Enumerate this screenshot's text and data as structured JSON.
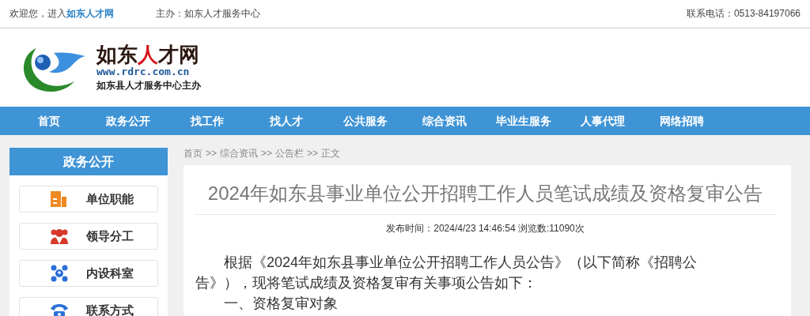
{
  "top_bar": {
    "welcome": "欢迎您，进入",
    "site_link": "如东人才网",
    "host": "主办：如东人才服务中心",
    "phone": "联系电话：0513-84197066"
  },
  "logo": {
    "title_parts": [
      {
        "text": "如东",
        "accent": false
      },
      {
        "text": "人",
        "accent": true
      },
      {
        "text": "才网",
        "accent": false
      }
    ],
    "url": "www.rdrc.com.cn",
    "subtitle": "如东县人才服务中心主办"
  },
  "nav": [
    "首页",
    "政务公开",
    "找工作",
    "找人才",
    "公共服务",
    "综合资讯",
    "毕业生服务",
    "人事代理",
    "网络招聘"
  ],
  "sidebar": {
    "title": "政务公开",
    "items": [
      {
        "label": "单位职能",
        "kind": "building"
      },
      {
        "label": "领导分工",
        "kind": "people"
      },
      {
        "label": "内设科室",
        "kind": "network"
      },
      {
        "label": "联系方式",
        "kind": "phone"
      }
    ]
  },
  "breadcrumb": [
    "首页",
    ">>",
    "综合资讯",
    ">>",
    "公告栏",
    ">>",
    "正文"
  ],
  "article": {
    "title": "2024年如东县事业单位公开招聘工作人员笔试成绩及资格复审公告",
    "meta": "发布时间：2024/4/23 14:46:54 浏览数:11090次",
    "paragraphs": [
      "根据《2024年如东县事业单位公开招聘工作人员公告》（以下简称《招聘公告》），现将笔试成绩及资格复审有关事项公告如下：",
      "一、资格复审对象"
    ]
  }
}
